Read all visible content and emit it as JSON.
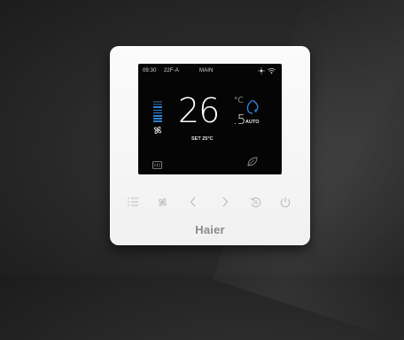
{
  "status_bar": {
    "time": "09:30",
    "outdoor": "22F-A",
    "menu": "MAIN"
  },
  "display": {
    "temperature_integer": "26",
    "temperature_decimal": ".5",
    "unit": "°C",
    "setpoint": "SET 25°C",
    "mode": "AUTO"
  },
  "fan_level": {
    "active_bars": 6,
    "total_bars": 8
  },
  "buttons": [
    "menu",
    "fan",
    "left",
    "right",
    "mode",
    "power"
  ],
  "brand": "Haier",
  "colors": {
    "accent": "#2d7fd0",
    "screen": "#050505",
    "panel": "#f5f5f5"
  },
  "icons": [
    "sun-icon",
    "wifi-icon",
    "fan-icon",
    "filter-icon",
    "auto-mode-icon",
    "eco-leaf-icon"
  ]
}
